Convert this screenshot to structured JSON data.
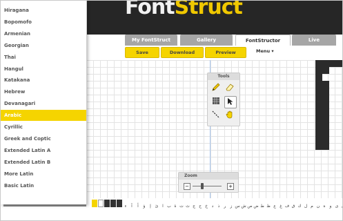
{
  "scripts_menu": {
    "items": [
      "Hiragana",
      "Bopomofo",
      "Armenian",
      "Georgian",
      "Thai",
      "Hangul",
      "Katakana",
      "Hebrew",
      "Devanagari",
      "Arabic",
      "Cyrillic",
      "Greek and Coptic",
      "Extended Latin A",
      "Extended Latin B",
      "More Latin",
      "Basic Latin"
    ],
    "selected": "Arabic"
  },
  "header": {
    "logo_part1": "Font",
    "logo_part2": "Struct"
  },
  "tabs": {
    "my_fontstruct": "My FontStruct",
    "gallery": "Gallery",
    "fontstructor": "FontStructor",
    "live": "Live",
    "active": "FontStructor"
  },
  "toolbar": {
    "save": "Save",
    "download": "Download",
    "preview": "Preview",
    "menu": "Menu ▾"
  },
  "tools_panel": {
    "title": "Tools",
    "tools": [
      "pencil-icon",
      "eraser-icon",
      "grid-fill-icon",
      "select-arrow-icon",
      "line-icon",
      "hand-icon"
    ]
  },
  "zoom_panel": {
    "title": "Zoom",
    "minus": "−",
    "plus": "+",
    "level": 0.35
  },
  "char_bar": {
    "glyphs": [
      "ﺀ",
      "ﺁ",
      "ﺃ",
      "ﺅ",
      "ﺇ",
      "ﺉ",
      "ﺍ",
      "ﺏ",
      "ﺓ",
      "ﺕ",
      "ﺙ",
      "ﺝ",
      "ﺡ",
      "ﺥ",
      "ﺩ",
      "ﺫ",
      "ﺭ",
      "ﺯ",
      "ﺱ",
      "ﺵ",
      "ﺹ",
      "ﺽ",
      "ﻁ",
      "ﻅ",
      "ﻉ",
      "ﻍ",
      "ﻑ",
      "ﻕ",
      "ﻙ",
      "ﻝ",
      "ﻡ",
      "ﻥ",
      "ﻩ",
      "ﻭ",
      "ﻯ",
      "ﻱ",
      "ي",
      "ى",
      "و"
    ]
  },
  "colors": {
    "accent": "#f5d400",
    "header": "#262626",
    "grid_line": "#e3e3e3",
    "guide": "#a8c6ee"
  }
}
